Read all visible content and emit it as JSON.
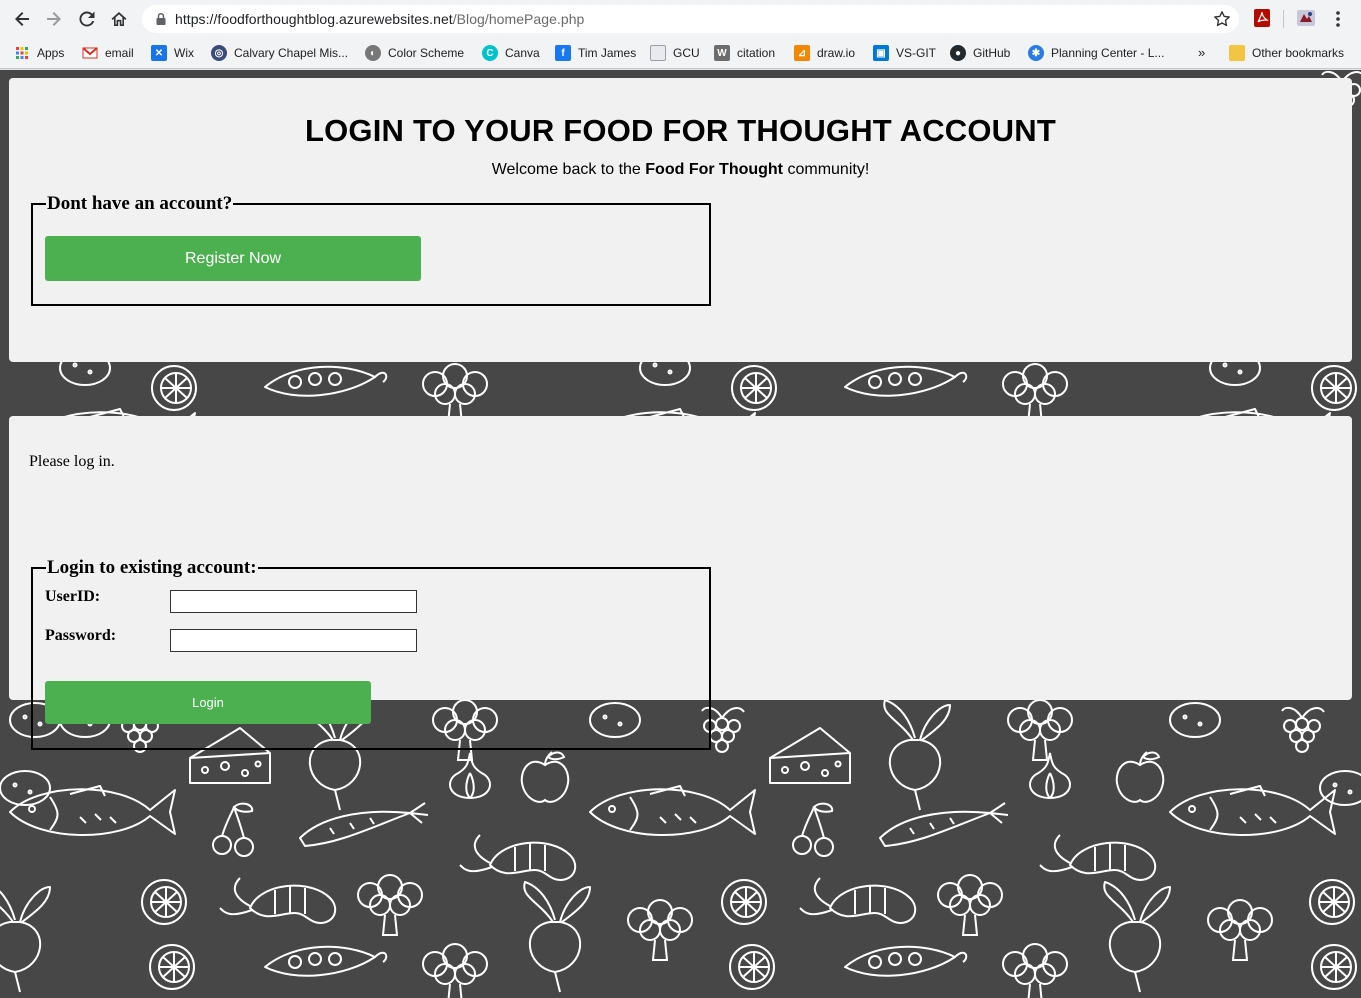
{
  "browser": {
    "url_host": "https://foodforthoughtblog.azurewebsites.net",
    "url_path": "/Blog/homePage.php",
    "bookmarks": [
      {
        "label": "Apps",
        "icon": "apps-grid-icon",
        "color": "#ea4335"
      },
      {
        "label": "email",
        "icon": "gmail-icon",
        "color": "#d93025"
      },
      {
        "label": "Wix",
        "icon": "wix-icon",
        "color": "#1a73e8"
      },
      {
        "label": "Calvary Chapel Mis...",
        "icon": "calvary-icon",
        "color": "#3c4a7a"
      },
      {
        "label": "Color Scheme",
        "icon": "color-scheme-icon",
        "color": "#777777"
      },
      {
        "label": "Canva",
        "icon": "canva-icon",
        "color": "#00c4cc"
      },
      {
        "label": "Tim James",
        "icon": "facebook-icon",
        "color": "#1877f2"
      },
      {
        "label": "GCU",
        "icon": "page-icon",
        "color": "#9aa0a6"
      },
      {
        "label": "citation",
        "icon": "citation-icon",
        "color": "#6d6d6d"
      },
      {
        "label": "draw.io",
        "icon": "drawio-icon",
        "color": "#f08705"
      },
      {
        "label": "VS-GIT",
        "icon": "vsts-icon",
        "color": "#0078d7"
      },
      {
        "label": "GitHub",
        "icon": "github-icon",
        "color": "#24292e"
      },
      {
        "label": "Planning Center - L...",
        "icon": "planning-center-icon",
        "color": "#2b7be4"
      }
    ],
    "more": "»",
    "other_bookmarks": "Other bookmarks"
  },
  "header": {
    "title": "LOGIN TO YOUR FOOD FOR THOUGHT ACCOUNT",
    "welcome_prefix": "Welcome back to the ",
    "welcome_bold": "Food For Thought",
    "welcome_suffix": " community!"
  },
  "register": {
    "legend": "Dont have an account?",
    "button": "Register Now"
  },
  "login": {
    "prompt": "Please log in.",
    "legend": "Login to existing account:",
    "userid_label": "UserID:",
    "userid_value": "",
    "password_label": "Password:",
    "password_value": "",
    "button": "Login"
  },
  "colors": {
    "accent": "#4caf50",
    "panel": "#f1f1f1",
    "background": "#474747"
  }
}
